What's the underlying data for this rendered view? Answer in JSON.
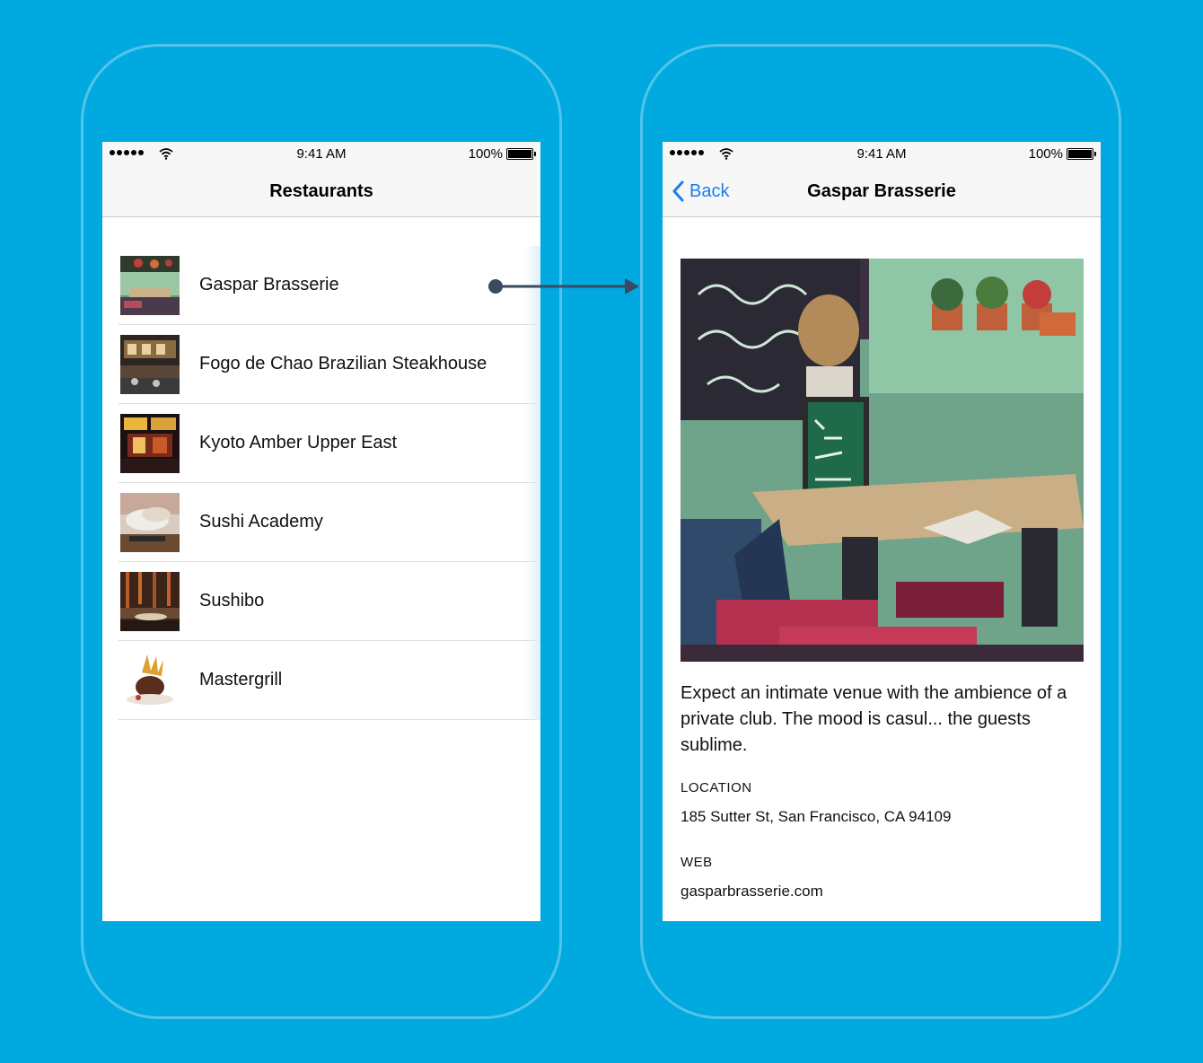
{
  "status_bar": {
    "time": "9:41 AM",
    "battery": "100%"
  },
  "list_screen": {
    "title": "Restaurants",
    "items": [
      {
        "name": "Gaspar Brasserie"
      },
      {
        "name": "Fogo de Chao Brazilian Steakhouse"
      },
      {
        "name": "Kyoto Amber Upper East"
      },
      {
        "name": "Sushi Academy"
      },
      {
        "name": "Sushibo"
      },
      {
        "name": "Mastergrill"
      }
    ]
  },
  "detail_screen": {
    "back_label": "Back",
    "title": "Gaspar Brasserie",
    "description": "Expect an intimate venue with the ambience of a private club. The mood is casul... the guests sublime.",
    "location_label": "LOCATION",
    "location_value": "185 Sutter St, San Francisco, CA 94109",
    "web_label": "WEB",
    "web_value": "gasparbrasserie.com"
  },
  "colors": {
    "background": "#00a9e0",
    "tint": "#1a7cf1",
    "connector": "#3a4a63"
  }
}
